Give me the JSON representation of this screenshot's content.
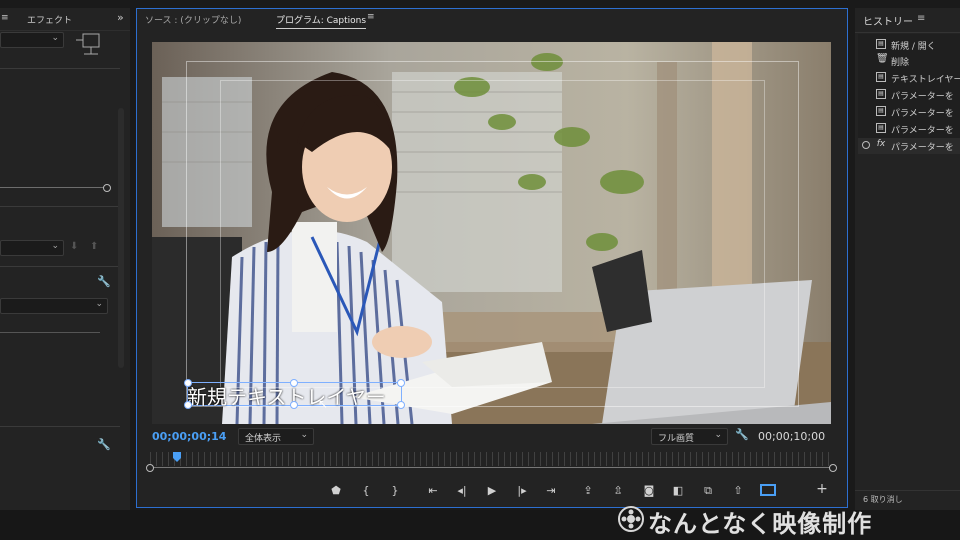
{
  "left_panel": {
    "tab_menu_icon": "≡",
    "tab_effects": "エフェクト",
    "more": "»"
  },
  "center": {
    "tab_source": "ソース : (クリップなし)",
    "tab_program": "プログラム: Captions",
    "tab_menu_icon": "≡",
    "timecode_current": "00;00;00;14",
    "zoom_value": "全体表示",
    "quality_value": "フル画質",
    "timecode_total": "00;00;10;00",
    "caption_text": "新規テキストレイヤー"
  },
  "history": {
    "title": "ヒストリー",
    "menu_icon": "≡",
    "items": [
      {
        "icon": "doc-icon",
        "label": "新規 / 開く"
      },
      {
        "icon": "trash-icon",
        "label": "削除"
      },
      {
        "icon": "doc-icon",
        "label": "テキストレイヤー"
      },
      {
        "icon": "doc-icon",
        "label": "パラメーターを"
      },
      {
        "icon": "doc-icon",
        "label": "パラメーターを"
      },
      {
        "icon": "doc-icon",
        "label": "パラメーターを"
      },
      {
        "icon": "fx-icon",
        "label": "パラメーターを"
      }
    ],
    "undo_count": "6 取り消し"
  },
  "watermark": "なんとなく映像制作",
  "colors": {
    "accent": "#2d6fd0",
    "timecode": "#4a9ff5",
    "panel": "#232323"
  }
}
